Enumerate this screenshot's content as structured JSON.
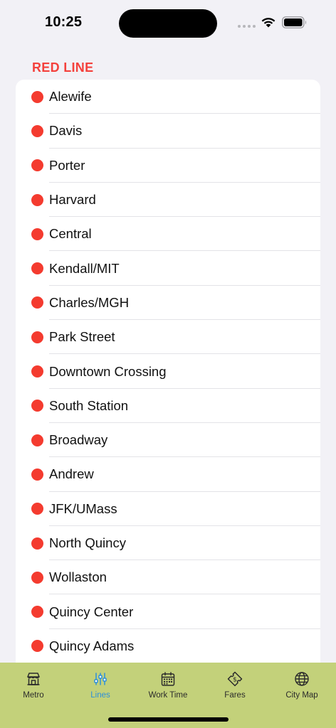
{
  "status_bar": {
    "time": "10:25"
  },
  "section": {
    "title": "RED LINE",
    "accent_color": "#f4413c",
    "dot_color": "#f43b2f",
    "stations": [
      "Alewife",
      "Davis",
      "Porter",
      "Harvard",
      "Central",
      "Kendall/MIT",
      "Charles/MGH",
      "Park Street",
      "Downtown Crossing",
      "South Station",
      "Broadway",
      "Andrew",
      "JFK/UMass",
      "North Quincy",
      "Wollaston",
      "Quincy Center",
      "Quincy Adams"
    ]
  },
  "tab_bar": {
    "background": "#c3d17a",
    "active_color": "#2d8fd9",
    "tabs": [
      {
        "label": "Metro",
        "icon": "store-icon"
      },
      {
        "label": "Lines",
        "icon": "sliders-icon",
        "active": true
      },
      {
        "label": "Work Time",
        "icon": "calendar-icon"
      },
      {
        "label": "Fares",
        "icon": "ticket-icon"
      },
      {
        "label": "City Map",
        "icon": "globe-icon"
      }
    ]
  }
}
